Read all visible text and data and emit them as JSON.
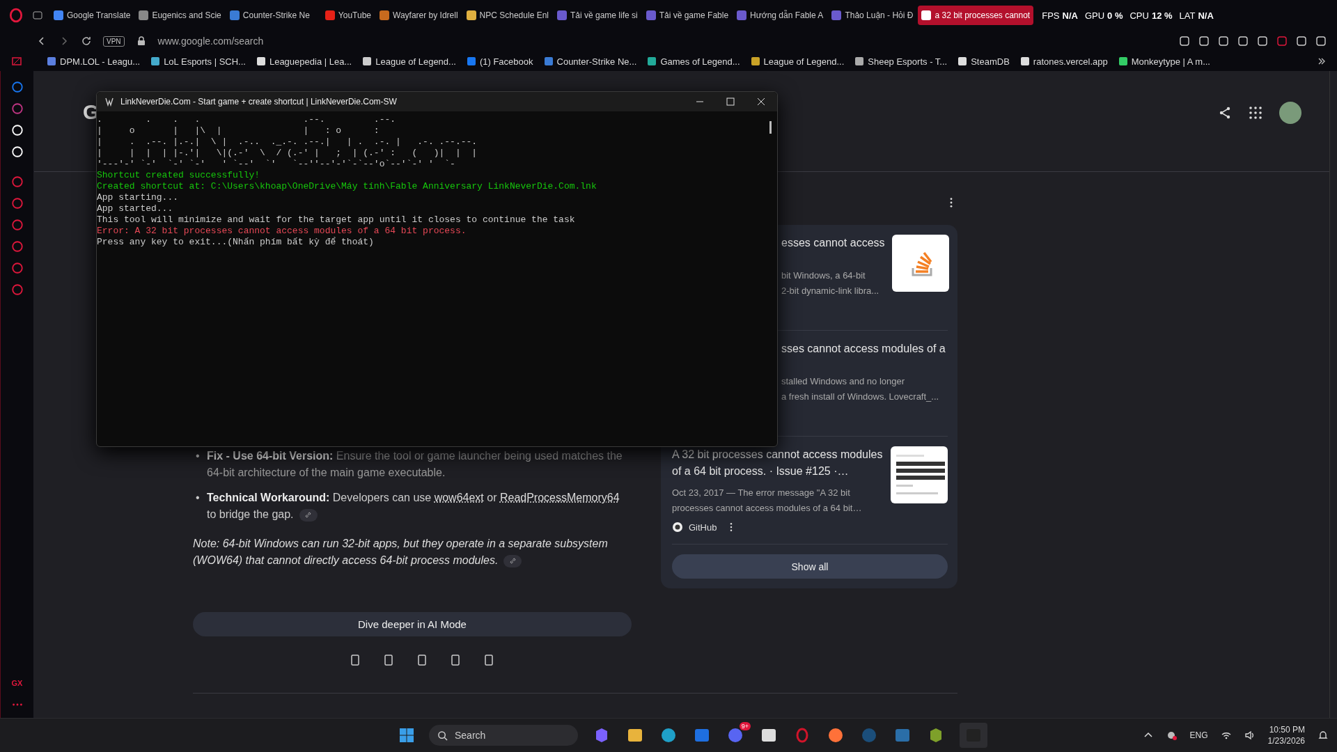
{
  "browser": {
    "tabs": [
      {
        "title": "Google Translate",
        "selected": false
      },
      {
        "title": "Eugenics and Scie",
        "selected": false
      },
      {
        "title": "Counter-Strike Ne",
        "selected": false
      },
      {
        "title": "YouTube",
        "selected": false
      },
      {
        "title": "Wayfarer by Idrell",
        "selected": false
      },
      {
        "title": "NPC Schedule Enl",
        "selected": false
      },
      {
        "title": "Tải về game life si",
        "selected": false
      },
      {
        "title": "Tải về game Fable",
        "selected": false
      },
      {
        "title": "Hướng dẫn Fable A",
        "selected": false
      },
      {
        "title": "Thảo Luận - Hỏi Đ",
        "selected": false
      },
      {
        "title": "a 32 bit processes cannot",
        "selected": true
      }
    ],
    "perf_overlay": [
      {
        "label": "FPS",
        "value": "N/A"
      },
      {
        "label": "GPU",
        "value": "0 %"
      },
      {
        "label": "CPU",
        "value": "12 %"
      },
      {
        "label": "LAT",
        "value": "N/A"
      }
    ],
    "vpn_badge": "VPN",
    "address": "www.google.com/search",
    "bookmarks": [
      "DPM.LOL - Leagu...",
      "LoL Esports | SCH...",
      "Leaguepedia | Lea...",
      "League of Legend...",
      "(1) Facebook",
      "Counter-Strike Ne...",
      "Games of Legend...",
      "League of Legend...",
      "Sheep Esports - T...",
      "SteamDB",
      "ratones.vercel.app",
      "Monkeytype | A m..."
    ],
    "sidebar_logo": "GX"
  },
  "page": {
    "logo_fragment": "G",
    "bullets": [
      {
        "marker": "•",
        "segments": [
          {
            "kind": "bold",
            "text": "Fix - Use 64-bit Version:"
          },
          {
            "kind": "text",
            "text": " Ensure the tool or game launcher being used matches the 64-bit architecture of the main game executable."
          }
        ]
      },
      {
        "marker": "•",
        "segments": [
          {
            "kind": "bold",
            "text": "Technical Workaround:"
          },
          {
            "kind": "text",
            "text": " Developers can use "
          },
          {
            "kind": "link",
            "text": "wow64ext"
          },
          {
            "kind": "text",
            "text": " or "
          },
          {
            "kind": "link",
            "text": "ReadProcessMemory64"
          },
          {
            "kind": "text",
            "text": " to bridge the gap."
          }
        ],
        "citation": true
      }
    ],
    "note": "Note: 64-bit Windows can run 32-bit apps, but they operate in a separate subsystem (WOW64) that cannot directly access 64-bit process modules.",
    "ai_button": "Dive deeper in AI Mode",
    "sources": [
      {
        "title": "esses cannot access",
        "snippet": [
          "bit Windows, a 64-bit",
          "2-bit dynamic-link libra..."
        ],
        "kind": "stacklogo",
        "covered": true
      },
      {
        "title": "sses cannot access modules of a",
        "snippet": [
          "stalled Windows and no longer",
          "a fresh install of Windows. Lovecraft_..."
        ],
        "kind": "textonly",
        "covered": true
      },
      {
        "title": "A 32 bit processes cannot access modules of a 64 bit process. · Issue #125 ·…",
        "snippet": [
          "Oct 23, 2017 — The error message \"A 32 bit processes cannot access modules of a 64 bit…"
        ],
        "source": "GitHub",
        "kind": "pagethumb",
        "covered": false
      }
    ],
    "show_all": "Show all"
  },
  "console": {
    "title": "LinkNeverDie.Com - Start game + create shortcut | LinkNeverDie.Com-SW",
    "lines": [
      {
        "kind": "ascii",
        "text": ".        .    .   .                   .--.         .--."
      },
      {
        "kind": "ascii",
        "text": "|     o       |   |\\  |               |   : o      :"
      },
      {
        "kind": "ascii",
        "text": "|     .  .--. |.-.|  \\ |  .-..  ._.-. .--.|   | .  .-. |   .-. .--.--."
      },
      {
        "kind": "ascii",
        "text": "|     |  |  | |-.'|   \\|(.-'  \\  / (.-' |   ;  | (.-' :   (   )|  |  |"
      },
      {
        "kind": "ascii",
        "text": "'---'-' `-'  `-' `-'   ' `--'  `'   `--''--'-'`-`--'o`--'`-' '  `-"
      },
      {
        "kind": "success",
        "text": "Shortcut created successfully!"
      },
      {
        "kind": "success",
        "text": "Created shortcut at: C:\\Users\\khoap\\OneDrive\\Máy tính\\Fable Anniversary LinkNeverDie.Com.lnk"
      },
      {
        "kind": "normal",
        "text": "App starting..."
      },
      {
        "kind": "normal",
        "text": "App started..."
      },
      {
        "kind": "normal",
        "text": "This tool will minimize and wait for the target app until it closes to continue the task"
      },
      {
        "kind": "error",
        "text": "Error: A 32 bit processes cannot access modules of a 64 bit process."
      },
      {
        "kind": "normal",
        "text": "Press any key to exit...(Nhấn phím bất kỳ để thoát)"
      }
    ]
  },
  "taskbar": {
    "search_placeholder": "Search",
    "notification_badge": "9+",
    "language": "ENG",
    "time": "10:50 PM",
    "date": "1/23/2026"
  }
}
